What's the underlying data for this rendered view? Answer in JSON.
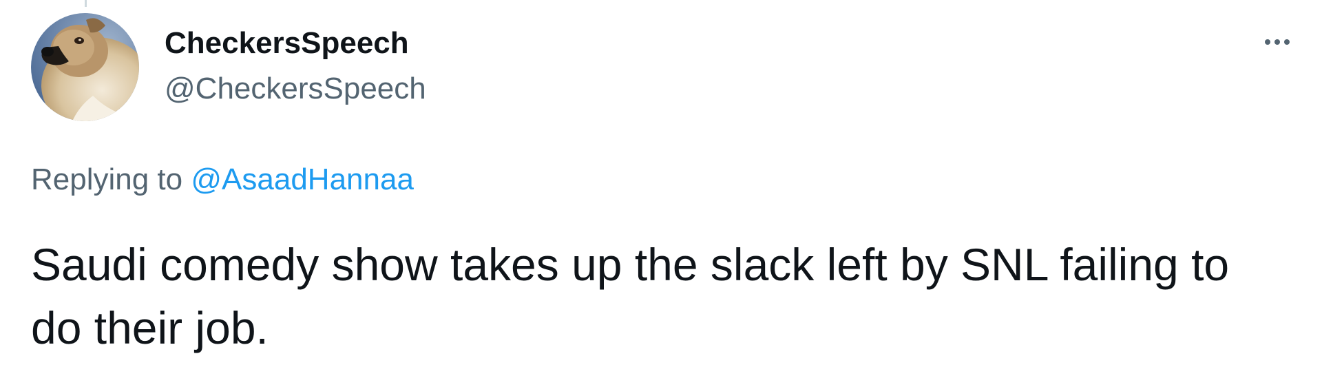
{
  "tweet": {
    "author": {
      "display_name": "CheckersSpeech",
      "handle": "@CheckersSpeech",
      "avatar_icon": "dog-avatar"
    },
    "more_icon": "more-horizontal-icon",
    "reply": {
      "prefix": "Replying to",
      "mention": "@AsaadHannaa"
    },
    "text": "Saudi comedy show takes up the slack left by SNL failing to do their job."
  },
  "colors": {
    "primary_text": "#0f1419",
    "secondary_text": "#536471",
    "link": "#1d9bf0"
  }
}
